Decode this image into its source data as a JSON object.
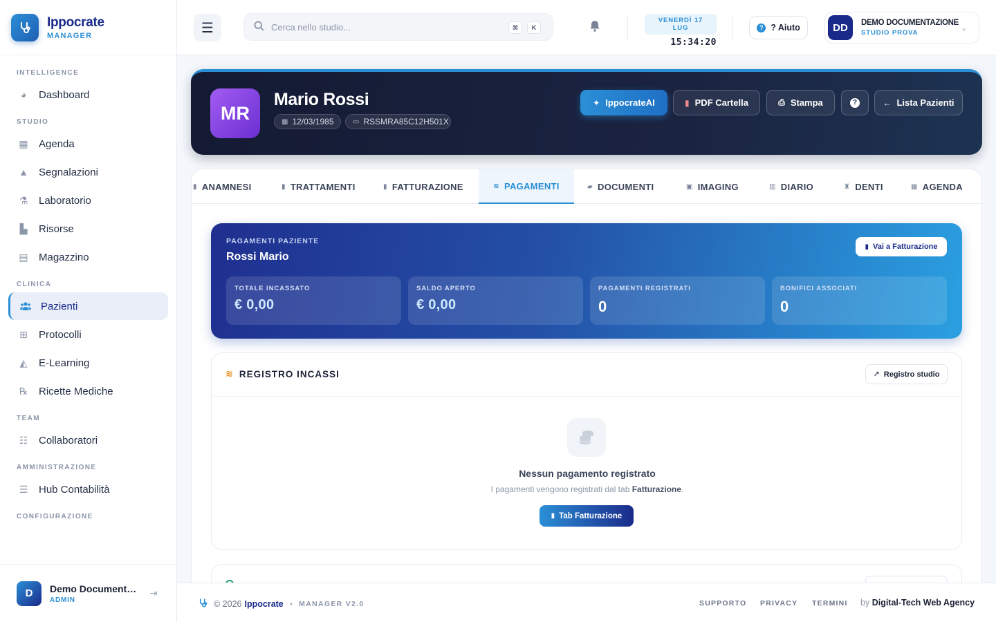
{
  "brand": {
    "name": "Ippocrate",
    "subtitle": "MANAGER"
  },
  "sidebar": {
    "sections": [
      {
        "title": "INTELLIGENCE",
        "items": [
          {
            "label": "Dashboard",
            "icon": "chart-pie-icon"
          }
        ]
      },
      {
        "title": "STUDIO",
        "items": [
          {
            "label": "Agenda",
            "icon": "calendar-icon"
          },
          {
            "label": "Segnalazioni",
            "icon": "bell-icon"
          },
          {
            "label": "Laboratorio",
            "icon": "flask-icon"
          },
          {
            "label": "Risorse",
            "icon": "book-icon"
          },
          {
            "label": "Magazzino",
            "icon": "warehouse-icon"
          }
        ]
      },
      {
        "title": "CLINICA",
        "items": [
          {
            "label": "Pazienti",
            "icon": "users-icon",
            "active": true
          },
          {
            "label": "Protocolli",
            "icon": "protocol-icon"
          },
          {
            "label": "E-Learning",
            "icon": "graduation-cap-icon"
          },
          {
            "label": "Ricette Mediche",
            "icon": "prescription-icon"
          }
        ]
      },
      {
        "title": "TEAM",
        "items": [
          {
            "label": "Collaboratori",
            "icon": "team-icon"
          }
        ]
      },
      {
        "title": "AMMINISTRAZIONE",
        "items": [
          {
            "label": "Hub Contabilità",
            "icon": "coins-icon"
          }
        ]
      },
      {
        "title": "CONFIGURAZIONE",
        "items": []
      }
    ],
    "user": {
      "initial": "D",
      "name": "Demo Documentazione",
      "role": "ADMIN"
    }
  },
  "topbar": {
    "search_placeholder": "Cerca nello studio...",
    "shortcut_keys": [
      "⌘",
      "K"
    ],
    "date": "VENERDÌ 17 LUG",
    "time": "15:34:20",
    "help_label": "? Aiuto",
    "user": {
      "initials": "DD",
      "name": "DEMO DOCUMENTAZIONE",
      "studio": "STUDIO PROVA"
    }
  },
  "patient": {
    "initials": "MR",
    "name": "Mario Rossi",
    "birth_date": "12/03/1985",
    "fiscal_code": "RSSMRA85C12H501X",
    "actions": {
      "ai": "IppocrateAI",
      "pdf": "PDF Cartella",
      "print": "Stampa",
      "back": "Lista Pazienti"
    }
  },
  "tabs": [
    {
      "label": "ANAMNESI"
    },
    {
      "label": "TRATTAMENTI"
    },
    {
      "label": "FATTURAZIONE"
    },
    {
      "label": "PAGAMENTI",
      "active": true
    },
    {
      "label": "DOCUMENTI"
    },
    {
      "label": "IMAGING"
    },
    {
      "label": "DIARIO"
    },
    {
      "label": "DENTI"
    },
    {
      "label": "AGENDA"
    }
  ],
  "payments": {
    "section_label": "PAGAMENTI PAZIENTE",
    "patient_name": "Rossi Mario",
    "goto_billing": "Vai a Fatturazione",
    "stats": [
      {
        "label": "TOTALE INCASSATO",
        "value": "€ 0,00"
      },
      {
        "label": "SALDO APERTO",
        "value": "€ 0,00"
      },
      {
        "label": "PAGAMENTI REGISTRATI",
        "value": "0"
      },
      {
        "label": "BONIFICI ASSOCIATI",
        "value": "0"
      }
    ]
  },
  "registro": {
    "title": "REGISTRO INCASSI",
    "studio_button": "Registro studio",
    "empty_title": "Nessun pagamento registrato",
    "empty_sub_prefix": "I pagamenti vengono registrati dal tab ",
    "empty_sub_link": "Fatturazione",
    "empty_sub_suffix": ".",
    "empty_button": "Tab Fatturazione"
  },
  "footer": {
    "copyright": "© 2026",
    "brand": "Ippocrate",
    "version": "MANAGER V2.0",
    "links": [
      "SUPPORTO",
      "PRIVACY",
      "TERMINI"
    ],
    "by_prefix": "by",
    "agency": "Digital-Tech Web Agency"
  },
  "colors": {
    "accent": "#2b8fd6",
    "brand_dark": "#1a2a8a",
    "hero_bg": "#141a33",
    "avatar_purple": "#8a46e6"
  }
}
